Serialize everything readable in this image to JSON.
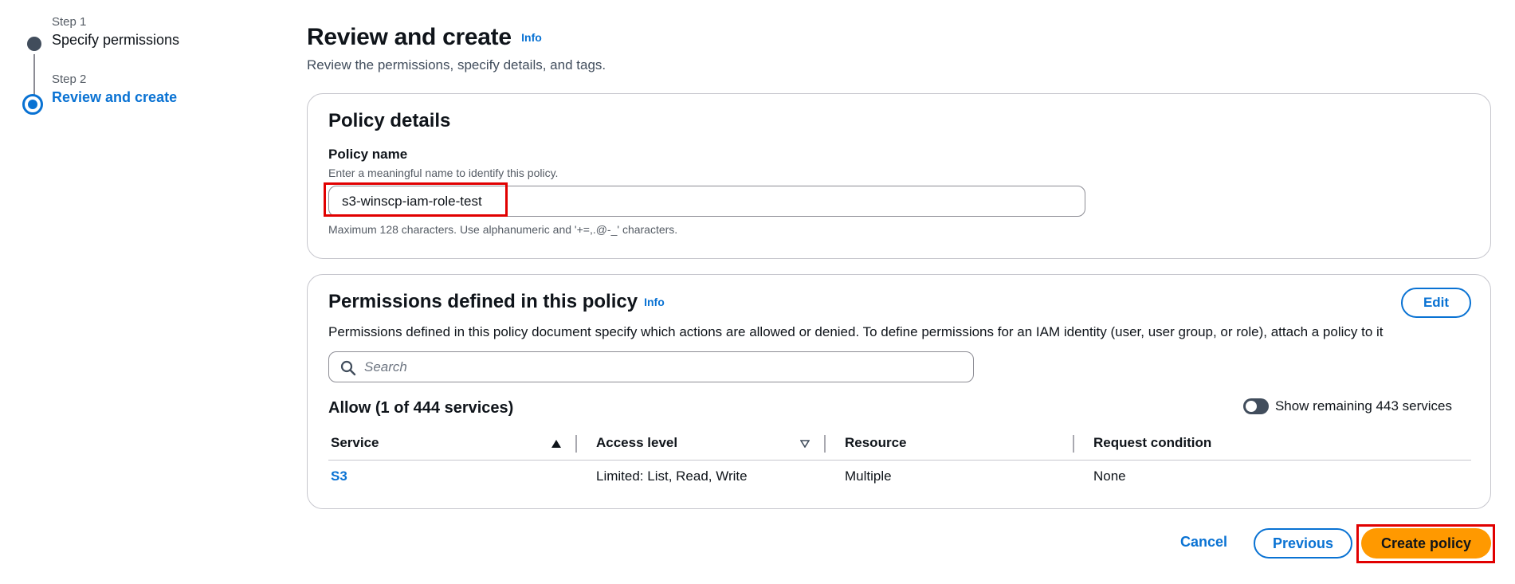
{
  "stepper": {
    "steps": [
      {
        "sub": "Step 1",
        "title": "Specify permissions"
      },
      {
        "sub": "Step 2",
        "title": "Review and create"
      }
    ]
  },
  "header": {
    "title": "Review and create",
    "info": "Info",
    "description": "Review the permissions, specify details, and tags."
  },
  "policy_details": {
    "title": "Policy details",
    "name_label": "Policy name",
    "name_description": "Enter a meaningful name to identify this policy.",
    "name_value": "s3-winscp-iam-role-test",
    "name_constraint": "Maximum 128 characters. Use alphanumeric and '+=,.@-_' characters."
  },
  "permissions": {
    "title": "Permissions defined in this policy",
    "info": "Info",
    "edit_label": "Edit",
    "description": "Permissions defined in this policy document specify which actions are allowed or denied. To define permissions for an IAM identity (user, user group, or role), attach a policy to it",
    "search_placeholder": "Search",
    "allow_title": "Allow (1 of 444 services)",
    "toggle_label": "Show remaining 443 services",
    "toggle_on": false,
    "columns": [
      "Service",
      "Access level",
      "Resource",
      "Request condition"
    ],
    "rows": [
      {
        "service": "S3",
        "access_level": "Limited: List, Read, Write",
        "resource": "Multiple",
        "request_condition": "None"
      }
    ]
  },
  "actions": {
    "cancel": "Cancel",
    "previous": "Previous",
    "create": "Create policy"
  },
  "colors": {
    "accent": "#0972d3",
    "primary_button": "#ff9900",
    "highlight": "#e10000"
  }
}
